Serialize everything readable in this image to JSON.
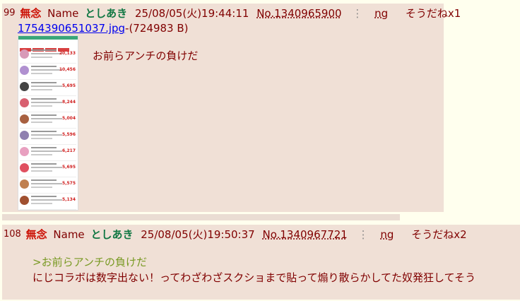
{
  "post1": {
    "number": "99",
    "subject": "無念",
    "name_label": "Name",
    "name": "としあき",
    "date": "25/08/05(火)19:44:11",
    "post_no": "No.1340965900",
    "menu_glyph": "⋮",
    "ng": "ng",
    "soudane": "そうだねx1",
    "file_name": "1754390651037.jpg",
    "file_size": "-(724983 B)",
    "message": "お前らアンチの負けだ"
  },
  "post2": {
    "number": "108",
    "subject": "無念",
    "name_label": "Name",
    "name": "としあき",
    "date": "25/08/05(火)19:50:37",
    "post_no": "No.1340967721",
    "menu_glyph": "⋮",
    "ng": "ng",
    "soudane": "そうだねx2",
    "quote": ">お前らアンチの負けだ",
    "message": "にじコラボは数字出ない！ってわざわざスクショまで貼って煽り散らかしてた奴発狂してそう"
  },
  "thumbnail": {
    "values": [
      "20,133",
      "10,456",
      "5,695",
      "8,244",
      "5,004",
      "5,596",
      "6,217",
      "5,695",
      "5,575",
      "5,134"
    ],
    "colors": [
      "#d89ab8",
      "#b090d0",
      "#444444",
      "#d86070",
      "#a86040",
      "#9080b0",
      "#e8a0c0",
      "#e05060",
      "#c08050",
      "#a05030"
    ]
  }
}
